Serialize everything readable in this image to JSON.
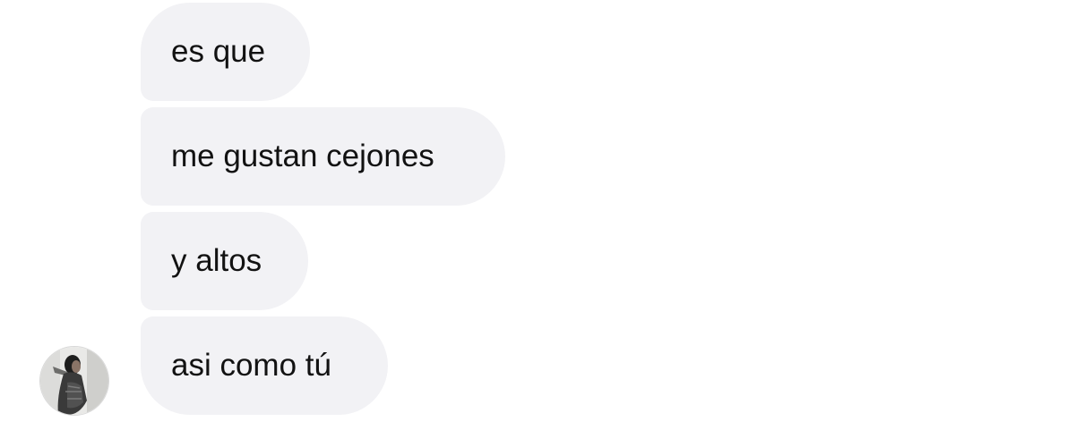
{
  "conversation": {
    "messages": [
      {
        "text": "es que"
      },
      {
        "text": "me gustan cejones"
      },
      {
        "text": "y altos"
      },
      {
        "text": "asi como tú"
      }
    ]
  },
  "sender": {
    "avatar_icon": "profile-photo"
  },
  "colors": {
    "background": "#ffffff",
    "bubble": "#f2f2f5",
    "text": "#121212"
  }
}
